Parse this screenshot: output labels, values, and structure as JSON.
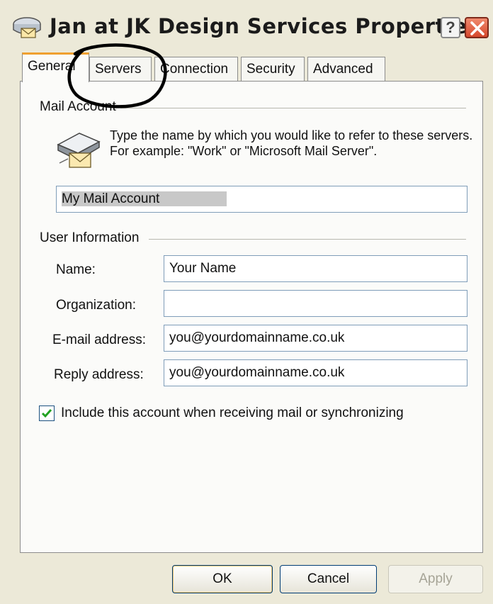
{
  "window": {
    "title": "Jan at JK Design Services Properties",
    "help_glyph": "?",
    "title_icon": "mail-account-icon"
  },
  "tabs": [
    {
      "label": "General",
      "active": true
    },
    {
      "label": "Servers",
      "active": false
    },
    {
      "label": "Connection",
      "active": false
    },
    {
      "label": "Security",
      "active": false
    },
    {
      "label": "Advanced",
      "active": false
    }
  ],
  "mail_account": {
    "group_label": "Mail Account",
    "description": "Type the name by which you would like to refer to these servers.  For example: \"Work\" or \"Microsoft Mail Server\".",
    "account_name": "My Mail Account"
  },
  "user_info": {
    "group_label": "User Information",
    "name_label": "Name:",
    "name_value": "Your Name",
    "organization_label": "Organization:",
    "organization_value": "",
    "email_label": "E-mail address:",
    "email_value": "you@yourdomainname.co.uk",
    "reply_label": "Reply address:",
    "reply_value": "you@yourdomainname.co.uk"
  },
  "include_account": {
    "label": "Include this account when receiving mail or synchronizing",
    "checked": true
  },
  "buttons": {
    "ok": "OK",
    "cancel": "Cancel",
    "apply": "Apply"
  },
  "colors": {
    "close_button": "#d6482c",
    "active_tab_accent": "#f0a030",
    "annotation_circle": "#000000"
  }
}
